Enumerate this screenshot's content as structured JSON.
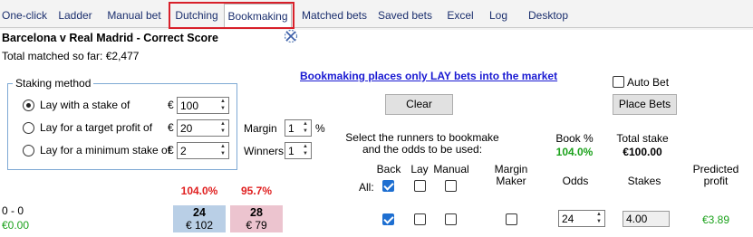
{
  "tabs": [
    {
      "label": "One-click"
    },
    {
      "label": "Ladder"
    },
    {
      "label": "Manual bet"
    },
    {
      "label": "Dutching"
    },
    {
      "label": "Bookmaking"
    },
    {
      "label": "Matched bets"
    },
    {
      "label": "Saved bets"
    },
    {
      "label": "Excel"
    },
    {
      "label": "Log"
    },
    {
      "label": "Desktop"
    }
  ],
  "active_tab": "Bookmaking",
  "market": {
    "title": "Barcelona v Real Madrid - Correct Score",
    "total_matched": "Total matched so far: €2,477"
  },
  "info_link": "Bookmaking places only LAY bets into the market",
  "staking": {
    "group_label": "Staking method",
    "options": [
      {
        "label": "Lay with a stake of",
        "currency": "€",
        "value": "100",
        "selected": true
      },
      {
        "label": "Lay for a target profit of",
        "currency": "€",
        "value": "20",
        "selected": false
      },
      {
        "label": "Lay for a minimum stake of",
        "currency": "€",
        "value": "2",
        "selected": false
      }
    ]
  },
  "margin": {
    "label": "Margin",
    "value": "1",
    "unit": "%"
  },
  "winners": {
    "label": "Winners",
    "value": "1"
  },
  "buttons": {
    "clear": "Clear",
    "place": "Place Bets"
  },
  "auto_bet": {
    "label": "Auto Bet",
    "checked": false
  },
  "instructions": {
    "line1": "Select the runners to bookmake",
    "line2": "and the odds to be used:"
  },
  "book": {
    "label": "Book %",
    "value": "104.0%"
  },
  "total_stake": {
    "label": "Total stake",
    "value": "€100.00"
  },
  "columns": {
    "back": "Back",
    "lay": "Lay",
    "manual": "Manual",
    "margin_maker_1": "Margin",
    "margin_maker_2": "Maker",
    "odds": "Odds",
    "stakes": "Stakes",
    "predicted_1": "Predicted",
    "predicted_2": "profit",
    "all": "All:"
  },
  "all_row": {
    "back": true,
    "lay": false,
    "manual": false
  },
  "overround": {
    "back": "104.0%",
    "lay": "95.7%"
  },
  "runners": [
    {
      "name": "0 - 0",
      "pl": "€0.00",
      "back_price": "24",
      "back_amount": "€ 102",
      "lay_price": "28",
      "lay_amount": "€ 79",
      "back": true,
      "lay": false,
      "manual": false,
      "margin_maker": false,
      "odds": "24",
      "stake": "4.00",
      "predicted_profit": "€3.89"
    }
  ],
  "colors": {
    "back": "#b9cfe6",
    "lay": "#ecc4cf",
    "positive": "#1ca21c",
    "negative": "#e02020",
    "link": "#1a1ad2",
    "tab_highlight": "#d8202a"
  }
}
